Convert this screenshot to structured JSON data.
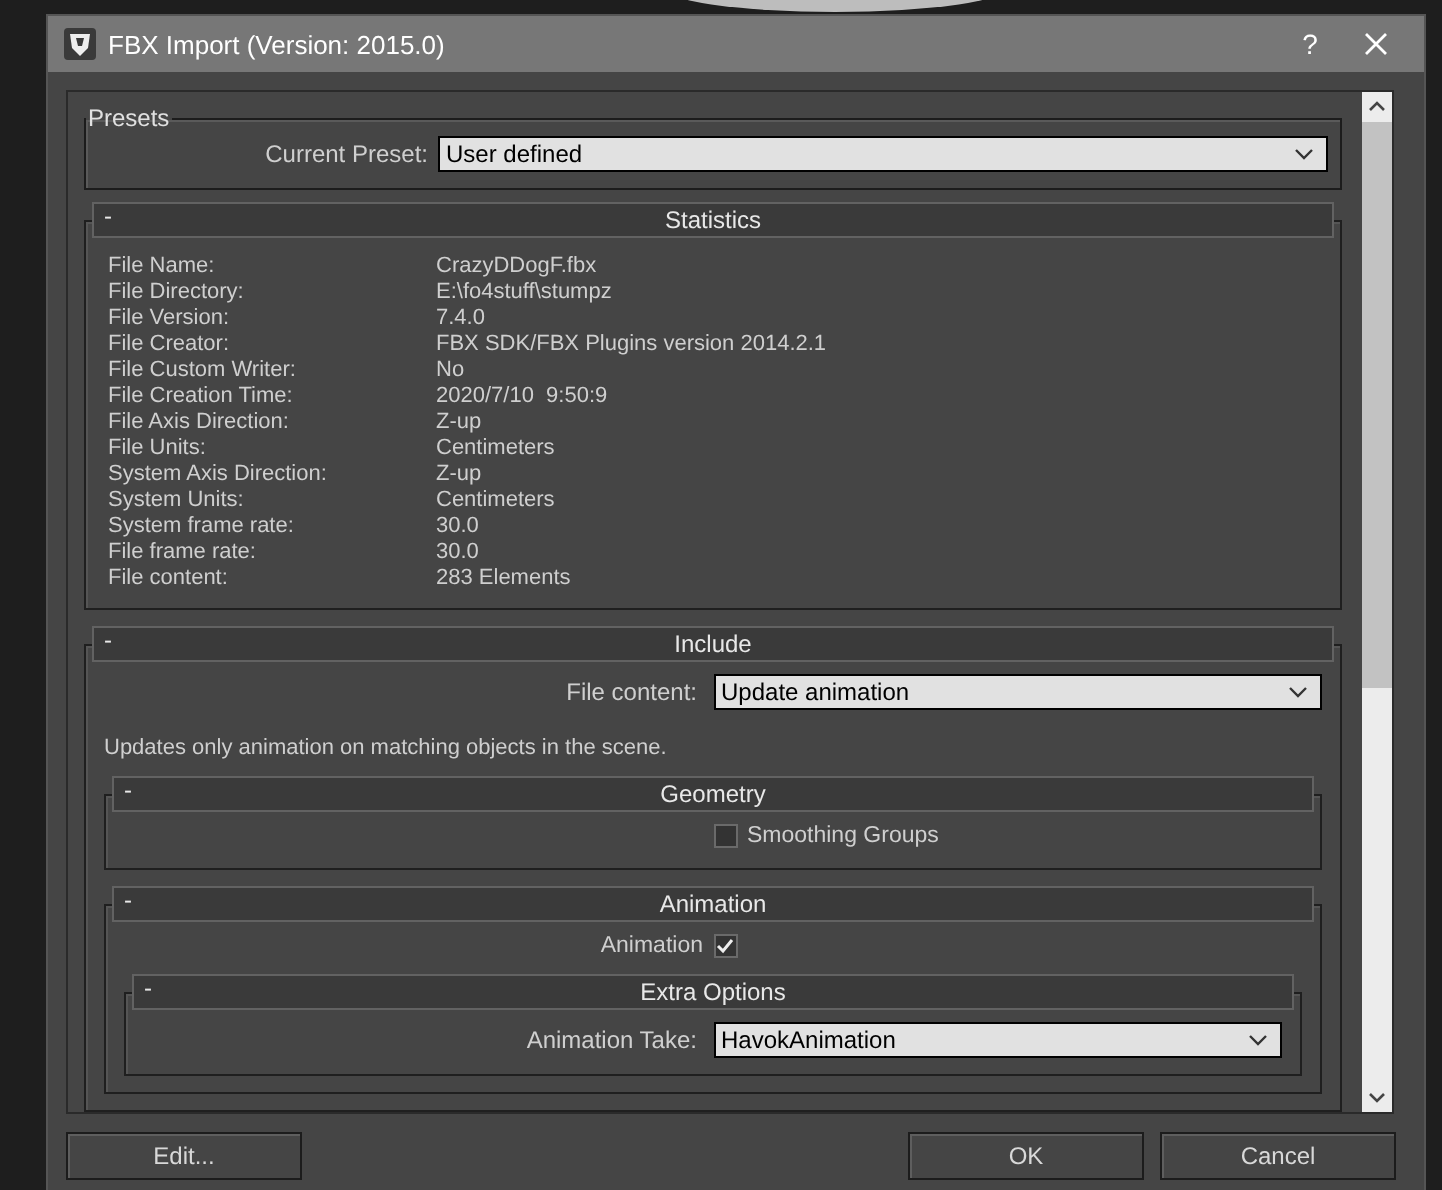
{
  "window": {
    "title": "FBX Import (Version: 2015.0)",
    "help": "?"
  },
  "presets": {
    "title": "Presets",
    "label": "Current Preset:",
    "value": "User defined"
  },
  "rollouts": [
    {
      "title": "Statistics",
      "toggle": "-",
      "rows": [
        {
          "label": "File Name:",
          "value": "CrazyDDogF.fbx"
        },
        {
          "label": "File Directory:",
          "value": "E:\\fo4stuff\\stumpz"
        },
        {
          "label": "File Version:",
          "value": "7.4.0"
        },
        {
          "label": "File Creator:",
          "value": "FBX SDK/FBX Plugins version 2014.2.1"
        },
        {
          "label": "File Custom Writer:",
          "value": "No"
        },
        {
          "label": "File Creation Time:",
          "value": "2020/7/10  9:50:9"
        },
        {
          "label": "File Axis Direction:",
          "value": "Z-up"
        },
        {
          "label": "File Units:",
          "value": "Centimeters"
        },
        {
          "label": "System Axis Direction:",
          "value": "Z-up"
        },
        {
          "label": "System Units:",
          "value": "Centimeters"
        },
        {
          "label": "System frame rate:",
          "value": "30.0"
        },
        {
          "label": "File frame rate:",
          "value": "30.0"
        },
        {
          "label": "File content:",
          "value": "283 Elements"
        }
      ]
    },
    {
      "title": "Include",
      "toggle": "-",
      "fields": [
        {
          "label": "File content:",
          "value": "Update animation"
        }
      ],
      "description": "Updates only animation on matching objects in the scene.",
      "children": [
        {
          "title": "Geometry",
          "toggle": "-",
          "checkboxes": [
            {
              "kind": "box-first",
              "label": "Smoothing Groups",
              "checked": false
            }
          ]
        },
        {
          "title": "Animation",
          "toggle": "-",
          "checkboxes": [
            {
              "kind": "label-first",
              "label": "Animation",
              "checked": true
            }
          ],
          "children": [
            {
              "title": "Extra Options",
              "toggle": "-",
              "fields": [
                {
                  "label": "Animation Take:",
                  "value": "HavokAnimation"
                }
              ]
            }
          ]
        }
      ]
    }
  ],
  "footer": {
    "left_buttons": [
      {
        "label": "Edit..."
      }
    ],
    "right_buttons": [
      {
        "label": "OK"
      },
      {
        "label": "Cancel"
      }
    ]
  }
}
